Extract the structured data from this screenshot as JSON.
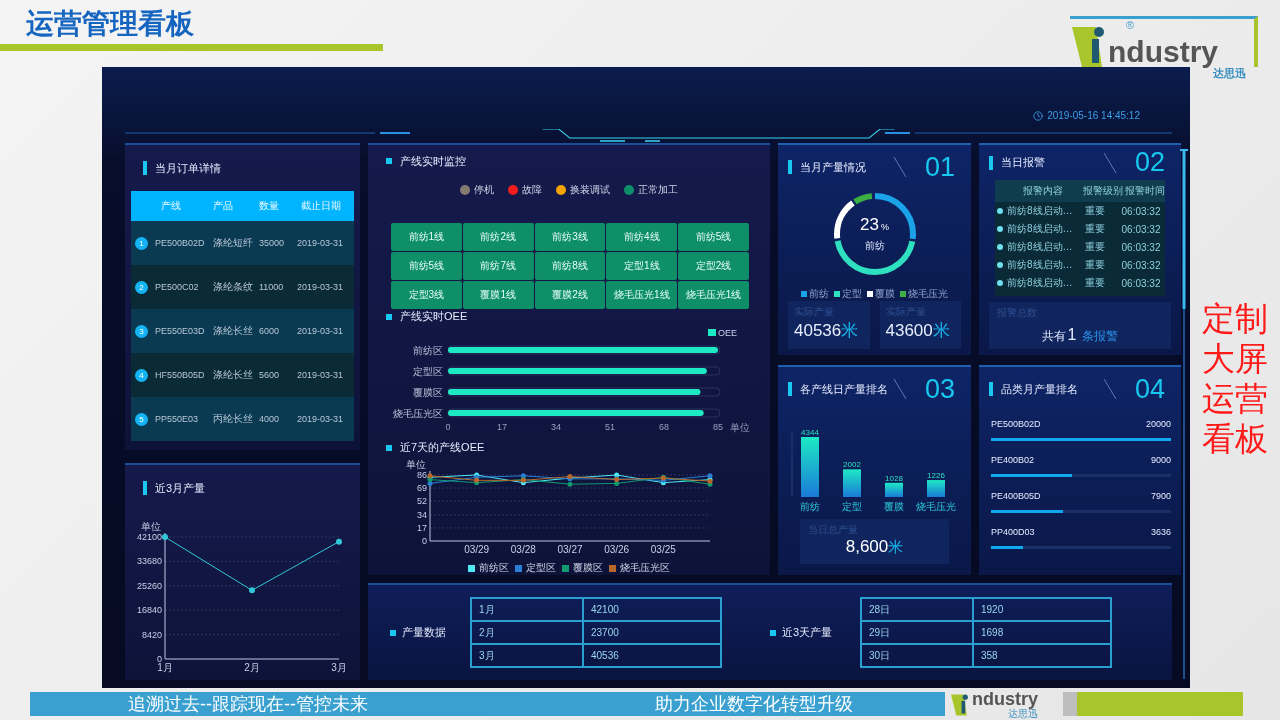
{
  "slide": {
    "title": "运营管理看板",
    "logo": {
      "brand": "ndustry",
      "mark": "®",
      "subtitle": "达思迅"
    },
    "side_note": [
      "定制",
      "大屏",
      "运营",
      "看板"
    ],
    "footer": {
      "slogan": "追溯过去--跟踪现在--管控未来",
      "tagline": "助力企业数字化转型升级",
      "logo": {
        "brand": "ndustry",
        "subtitle": "达思迅"
      }
    }
  },
  "dashboard": {
    "datetime": "2019-05-16 14:45:12",
    "orders": {
      "title": "当月订单详情",
      "columns": [
        "产线",
        "产品",
        "数量",
        "截止日期"
      ],
      "rows": [
        {
          "index": "1",
          "cells": [
            "PE500B02D",
            "涤纶短纤",
            "35000",
            "2019-03-31"
          ]
        },
        {
          "index": "2",
          "cells": [
            "PE500C02",
            "涤纶条纹",
            "11000",
            "2019-03-31"
          ]
        },
        {
          "index": "3",
          "cells": [
            "PE550E03D",
            "涤纶长丝",
            "6000",
            "2019-03-31"
          ]
        },
        {
          "index": "4",
          "cells": [
            "HF550B05D",
            "涤纶长丝",
            "5600",
            "2019-03-31"
          ]
        },
        {
          "index": "5",
          "cells": [
            "PP550E03",
            "丙纶长丝",
            "4000",
            "2019-03-31"
          ]
        }
      ]
    },
    "three_month": {
      "title": "近3月产量",
      "chart_data": {
        "type": "line",
        "ylabel": "单位",
        "categories": [
          "1月",
          "2月",
          "3月"
        ],
        "values": [
          42100,
          23700,
          40500
        ],
        "ylim": [
          0,
          42100
        ],
        "yticks": [
          0,
          8420,
          16840,
          25260,
          33680,
          42100
        ],
        "grid": true,
        "marker": true
      }
    },
    "monitor": {
      "title": "产线实时监控",
      "legend": [
        {
          "label": "停机",
          "color": "#857a70"
        },
        {
          "label": "故障",
          "color": "#f21c1c"
        },
        {
          "label": "换装调试",
          "color": "#f5a300"
        },
        {
          "label": "正常加工",
          "color": "#0e8f68"
        }
      ],
      "tiles": [
        {
          "label": "前纺1线",
          "color": "#0e8f68"
        },
        {
          "label": "前纺2线",
          "color": "#0e8f68"
        },
        {
          "label": "前纺3线",
          "color": "#0e8f68"
        },
        {
          "label": "前纺4线",
          "color": "#0e8f68"
        },
        {
          "label": "前纺5线",
          "color": "#0e8f68"
        },
        {
          "label": "前纺5线",
          "color": "#0e8f68"
        },
        {
          "label": "前纺7线",
          "color": "#0e8f68"
        },
        {
          "label": "前纺8线",
          "color": "#0e8f68"
        },
        {
          "label": "定型1线",
          "color": "#0e8f68"
        },
        {
          "label": "定型2线",
          "color": "#0e8f68"
        },
        {
          "label": "定型3线",
          "color": "#0e8f68"
        },
        {
          "label": "覆膜1线",
          "color": "#0e8f68"
        },
        {
          "label": "覆膜2线",
          "color": "#0e8f68"
        },
        {
          "label": "烧毛压光1线",
          "color": "#0e8f68"
        },
        {
          "label": "烧毛压光1线",
          "color": "#0e8f68"
        }
      ]
    },
    "oee": {
      "title": "产线实时OEE",
      "chart_data": {
        "type": "bar",
        "orientation": "horizontal",
        "xlabel": "单位",
        "categories": [
          "前纺区",
          "定型区",
          "覆膜区",
          "烧毛压光区"
        ],
        "series": [
          {
            "name": "OEE",
            "color": "#1de9c4",
            "values": [
              85,
              81.5,
              79.5,
              80.5
            ]
          }
        ],
        "xlim": [
          0,
          85
        ],
        "xticks": [
          0,
          17,
          34,
          51,
          68,
          85
        ]
      }
    },
    "oee_week": {
      "title": "近7天的产线OEE",
      "chart_data": {
        "type": "line",
        "ylabel": "单位",
        "categories": [
          null,
          "03/29",
          "03/28",
          "03/27",
          "03/26",
          "03/25",
          null
        ],
        "ylim": [
          0,
          86
        ],
        "yticks": [
          0,
          17,
          34,
          52,
          69,
          86
        ],
        "grid": true,
        "marker": true,
        "series": [
          {
            "name": "前纺区",
            "color": "#4de8f4",
            "values": [
              83,
              86,
              76,
              82,
              86,
              76,
              80
            ]
          },
          {
            "name": "定型区",
            "color": "#2a7fd4",
            "values": [
              75,
              83,
              85,
              81,
              81,
              79,
              85
            ]
          },
          {
            "name": "覆膜区",
            "color": "#0f9a70",
            "values": [
              80,
              76,
              80,
              74,
              75,
              83,
              74
            ]
          },
          {
            "name": "烧毛压光区",
            "color": "#b8672a",
            "values": [
              85,
              79,
              79,
              84,
              80,
              82,
              78
            ]
          }
        ]
      }
    },
    "month_output": {
      "title": "当月产量情况",
      "number": "01",
      "percent": "23",
      "percent_unit": "%",
      "center_label": "前纺",
      "legend": [
        {
          "label": "前纺",
          "color": "#1aa3e8"
        },
        {
          "label": "定型",
          "color": "#2ee0c0"
        },
        {
          "label": "覆膜",
          "color": "#ffffff"
        },
        {
          "label": "烧毛压光",
          "color": "#3cb043"
        }
      ],
      "stats": [
        {
          "label": "实际产量",
          "value": "40536",
          "unit": "米"
        },
        {
          "label": "实际产量",
          "value": "43600",
          "unit": "米"
        }
      ]
    },
    "alarms": {
      "title": "当日报警",
      "number": "02",
      "columns": [
        "报警内容",
        "报警级别",
        "报警时间"
      ],
      "rows": [
        {
          "cells": [
            "前纺8线启动…",
            "重要",
            "06:03:32"
          ]
        },
        {
          "cells": [
            "前纺8线启动…",
            "重要",
            "06:03:32"
          ]
        },
        {
          "cells": [
            "前纺8线启动…",
            "重要",
            "06:03:32"
          ]
        },
        {
          "cells": [
            "前纺8线启动…",
            "重要",
            "06:03:32"
          ]
        },
        {
          "cells": [
            "前纺8线启动…",
            "重要",
            "06:03:32"
          ]
        }
      ],
      "summary": {
        "label": "报警总数",
        "prefix": "共有",
        "count": "1",
        "suffix": "条报警"
      }
    },
    "daily_rank": {
      "title": "各产线日产量排名",
      "number": "03",
      "chart_data": {
        "type": "bar",
        "categories": [
          "前纺",
          "定型",
          "覆膜",
          "烧毛压光"
        ],
        "values": [
          4344,
          2002,
          1028,
          1226
        ],
        "data_labels": true
      },
      "total": {
        "label": "当日总产量",
        "value": "8,600",
        "unit": "米"
      }
    },
    "category_rank": {
      "title": "品类月产量排名",
      "number": "04",
      "items": [
        {
          "name": "PE500B02D",
          "value": "20000",
          "level": 1
        },
        {
          "name": "PE400B02",
          "value": "9000",
          "level": 0.45
        },
        {
          "name": "PE400B05D",
          "value": "7900",
          "level": 0.4
        },
        {
          "name": "PP400D03",
          "value": "3636",
          "level": 0.18
        }
      ]
    },
    "output_data": {
      "title": "产量数据",
      "rows": [
        [
          "1月",
          "42100"
        ],
        [
          "2月",
          "23700"
        ],
        [
          "3月",
          "40536"
        ]
      ]
    },
    "recent_output": {
      "title": "近3天产量",
      "rows": [
        [
          "28日",
          "1920"
        ],
        [
          "29日",
          "1698"
        ],
        [
          "30日",
          "358"
        ]
      ]
    }
  }
}
